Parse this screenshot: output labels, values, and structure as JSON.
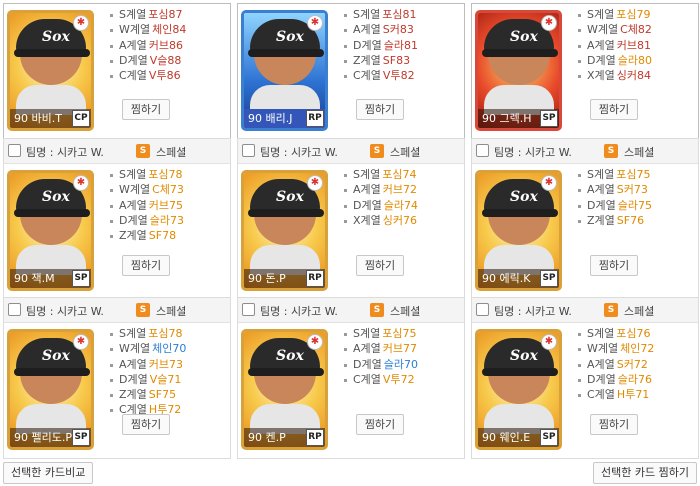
{
  "colors": {
    "accent": "#f08c1e",
    "value_red": "#c0392b",
    "value_orange": "#e08a00",
    "value_blue": "#2a7fd4"
  },
  "header": {
    "team_label": "팀명 : 시카고 W.",
    "special_label": "스페셜",
    "special_badge": "S"
  },
  "zzim_label": "찜하기",
  "cards": [
    {
      "name": "90 바비.T",
      "position": "CP",
      "frame": "gold",
      "show_header": false,
      "stats": [
        {
          "cat": "S계열",
          "val": "포심87",
          "color": "#c0392b"
        },
        {
          "cat": "W계열",
          "val": "체인84",
          "color": "#c0392b"
        },
        {
          "cat": "A계열",
          "val": "커브86",
          "color": "#c0392b"
        },
        {
          "cat": "D계열",
          "val": "V슬88",
          "color": "#c0392b"
        },
        {
          "cat": "C계열",
          "val": "V투86",
          "color": "#c0392b"
        }
      ]
    },
    {
      "name": "90 배리.J",
      "position": "RP",
      "frame": "blue",
      "show_header": false,
      "stats": [
        {
          "cat": "S계열",
          "val": "포심81",
          "color": "#c0392b"
        },
        {
          "cat": "A계열",
          "val": "S커83",
          "color": "#c0392b"
        },
        {
          "cat": "D계열",
          "val": "슬라81",
          "color": "#c0392b"
        },
        {
          "cat": "Z계열",
          "val": "SF83",
          "color": "#c0392b"
        },
        {
          "cat": "C계열",
          "val": "V투82",
          "color": "#c0392b"
        }
      ]
    },
    {
      "name": "90 그렉.H",
      "position": "SP",
      "frame": "red",
      "show_header": false,
      "stats": [
        {
          "cat": "S계열",
          "val": "포심79",
          "color": "#e08a00"
        },
        {
          "cat": "W계열",
          "val": "C체82",
          "color": "#c0392b"
        },
        {
          "cat": "A계열",
          "val": "커브81",
          "color": "#c0392b"
        },
        {
          "cat": "D계열",
          "val": "슬라80",
          "color": "#e08a00"
        },
        {
          "cat": "X계열",
          "val": "싱커84",
          "color": "#c0392b"
        }
      ]
    },
    {
      "name": "90 잭.M",
      "position": "SP",
      "frame": "gold",
      "show_header": true,
      "stats": [
        {
          "cat": "S계열",
          "val": "포심78",
          "color": "#e08a00"
        },
        {
          "cat": "W계열",
          "val": "C체73",
          "color": "#e08a00"
        },
        {
          "cat": "A계열",
          "val": "커브75",
          "color": "#e08a00"
        },
        {
          "cat": "D계열",
          "val": "슬라73",
          "color": "#e08a00"
        },
        {
          "cat": "Z계열",
          "val": "SF78",
          "color": "#e08a00"
        }
      ]
    },
    {
      "name": "90 돈.P",
      "position": "RP",
      "frame": "gold",
      "show_header": true,
      "stats": [
        {
          "cat": "S계열",
          "val": "포심74",
          "color": "#e08a00"
        },
        {
          "cat": "A계열",
          "val": "커브72",
          "color": "#e08a00"
        },
        {
          "cat": "D계열",
          "val": "슬라74",
          "color": "#e08a00"
        },
        {
          "cat": "X계열",
          "val": "싱커76",
          "color": "#e08a00"
        }
      ]
    },
    {
      "name": "90 에릭.K",
      "position": "SP",
      "frame": "gold",
      "show_header": true,
      "stats": [
        {
          "cat": "S계열",
          "val": "포심75",
          "color": "#e08a00"
        },
        {
          "cat": "A계열",
          "val": "S커73",
          "color": "#e08a00"
        },
        {
          "cat": "D계열",
          "val": "슬라75",
          "color": "#e08a00"
        },
        {
          "cat": "Z계열",
          "val": "SF76",
          "color": "#e08a00"
        }
      ]
    },
    {
      "name": "90 펠리도.P",
      "position": "SP",
      "frame": "gold",
      "show_header": true,
      "stats": [
        {
          "cat": "S계열",
          "val": "포심78",
          "color": "#e08a00"
        },
        {
          "cat": "W계열",
          "val": "체인70",
          "color": "#2a7fd4"
        },
        {
          "cat": "A계열",
          "val": "커브73",
          "color": "#e08a00"
        },
        {
          "cat": "D계열",
          "val": "V슬71",
          "color": "#e08a00"
        },
        {
          "cat": "Z계열",
          "val": "SF75",
          "color": "#e08a00"
        },
        {
          "cat": "C계열",
          "val": "H투72",
          "color": "#e08a00"
        }
      ]
    },
    {
      "name": "90 켄.P",
      "position": "RP",
      "frame": "gold",
      "show_header": true,
      "stats": [
        {
          "cat": "S계열",
          "val": "포심75",
          "color": "#e08a00"
        },
        {
          "cat": "A계열",
          "val": "커브77",
          "color": "#e08a00"
        },
        {
          "cat": "D계열",
          "val": "슬라70",
          "color": "#2a7fd4"
        },
        {
          "cat": "C계열",
          "val": "V투72",
          "color": "#e08a00"
        }
      ]
    },
    {
      "name": "90 웨인.E",
      "position": "SP",
      "frame": "gold",
      "show_header": true,
      "stats": [
        {
          "cat": "S계열",
          "val": "포심76",
          "color": "#e08a00"
        },
        {
          "cat": "W계열",
          "val": "체인72",
          "color": "#e08a00"
        },
        {
          "cat": "A계열",
          "val": "S커72",
          "color": "#e08a00"
        },
        {
          "cat": "D계열",
          "val": "슬라76",
          "color": "#e08a00"
        },
        {
          "cat": "C계열",
          "val": "H투71",
          "color": "#e08a00"
        }
      ]
    }
  ],
  "footer": {
    "compare_label": "선택한 카드비교",
    "zzim_selected_label": "선택한 카드 찜하기"
  }
}
